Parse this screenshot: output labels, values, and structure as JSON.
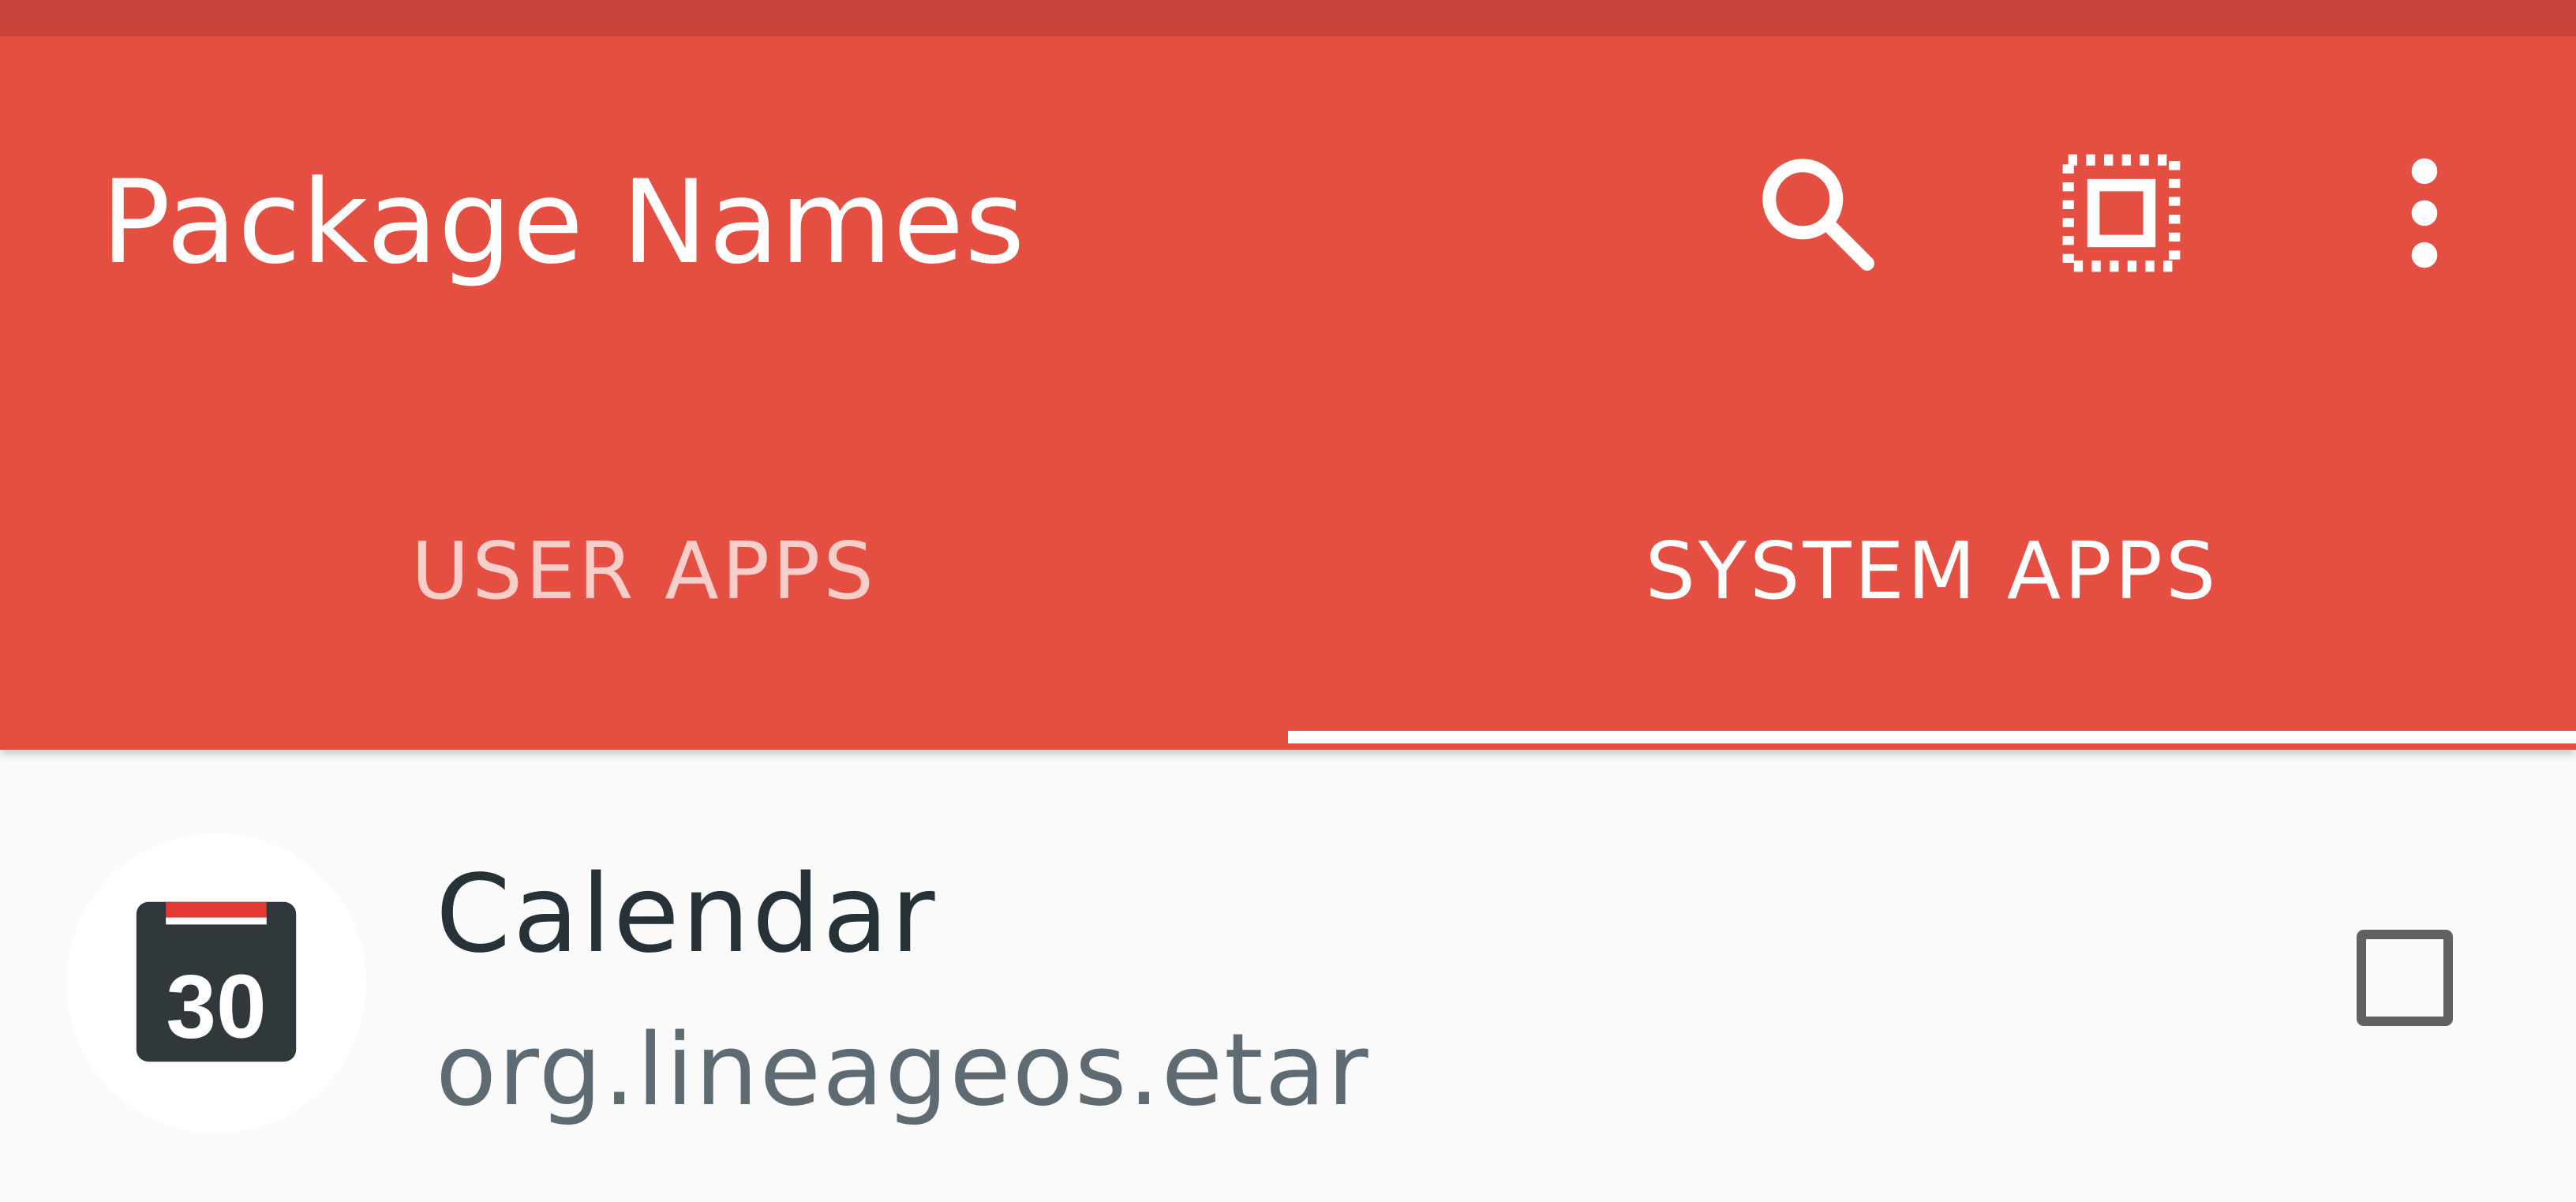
{
  "app_bar": {
    "title": "Package Names",
    "actions": [
      {
        "icon": "search-icon"
      },
      {
        "icon": "select-all-icon"
      },
      {
        "icon": "more-vert-icon"
      }
    ],
    "background_color": "#e44f42",
    "status_bar_color": "#c8443a"
  },
  "tabs": [
    {
      "label": "USER APPS",
      "selected": false
    },
    {
      "label": "SYSTEM APPS",
      "selected": true
    }
  ],
  "app_list": [
    {
      "name": "Calendar",
      "package": "org.lineageos.etar",
      "icon": "calendar-app-icon",
      "icon_text": "30",
      "checked": false
    }
  ]
}
